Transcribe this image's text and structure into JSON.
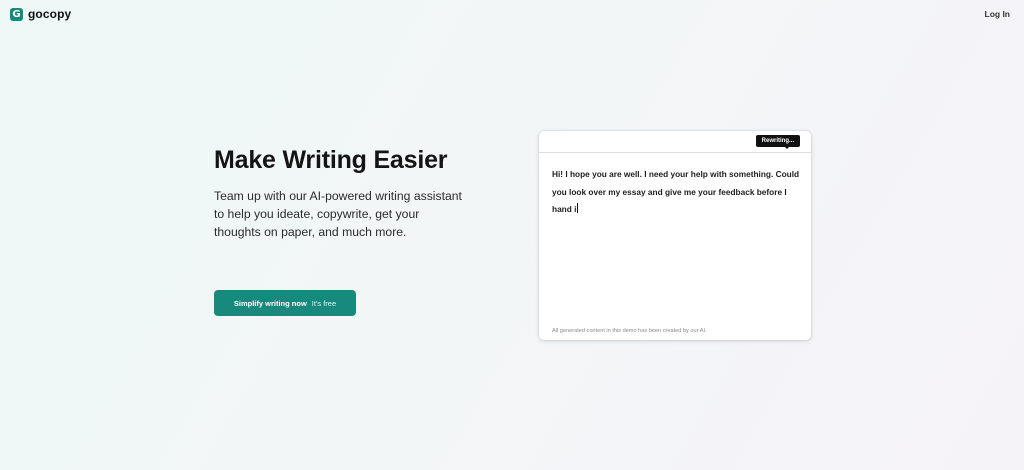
{
  "brand": {
    "logo_glyph": "G",
    "name": "gocopy",
    "color": "#178a78"
  },
  "nav": {
    "login_label": "Log In"
  },
  "hero": {
    "title": "Make Writing Easier",
    "subtitle": "Team up with our AI-powered writing assistant to help you ideate, copywrite, get your thoughts on paper, and much more."
  },
  "cta": {
    "main_label": "Simplify writing now",
    "aside_label": "It's free",
    "color": "#178a7d"
  },
  "editor": {
    "status_badge": "Rewriting...",
    "text": "Hi! I hope you are well. I need your help with something. Could you look over my essay and give me your feedback before I hand i",
    "footer_note": "All generated content in this demo has been created by our AI."
  }
}
